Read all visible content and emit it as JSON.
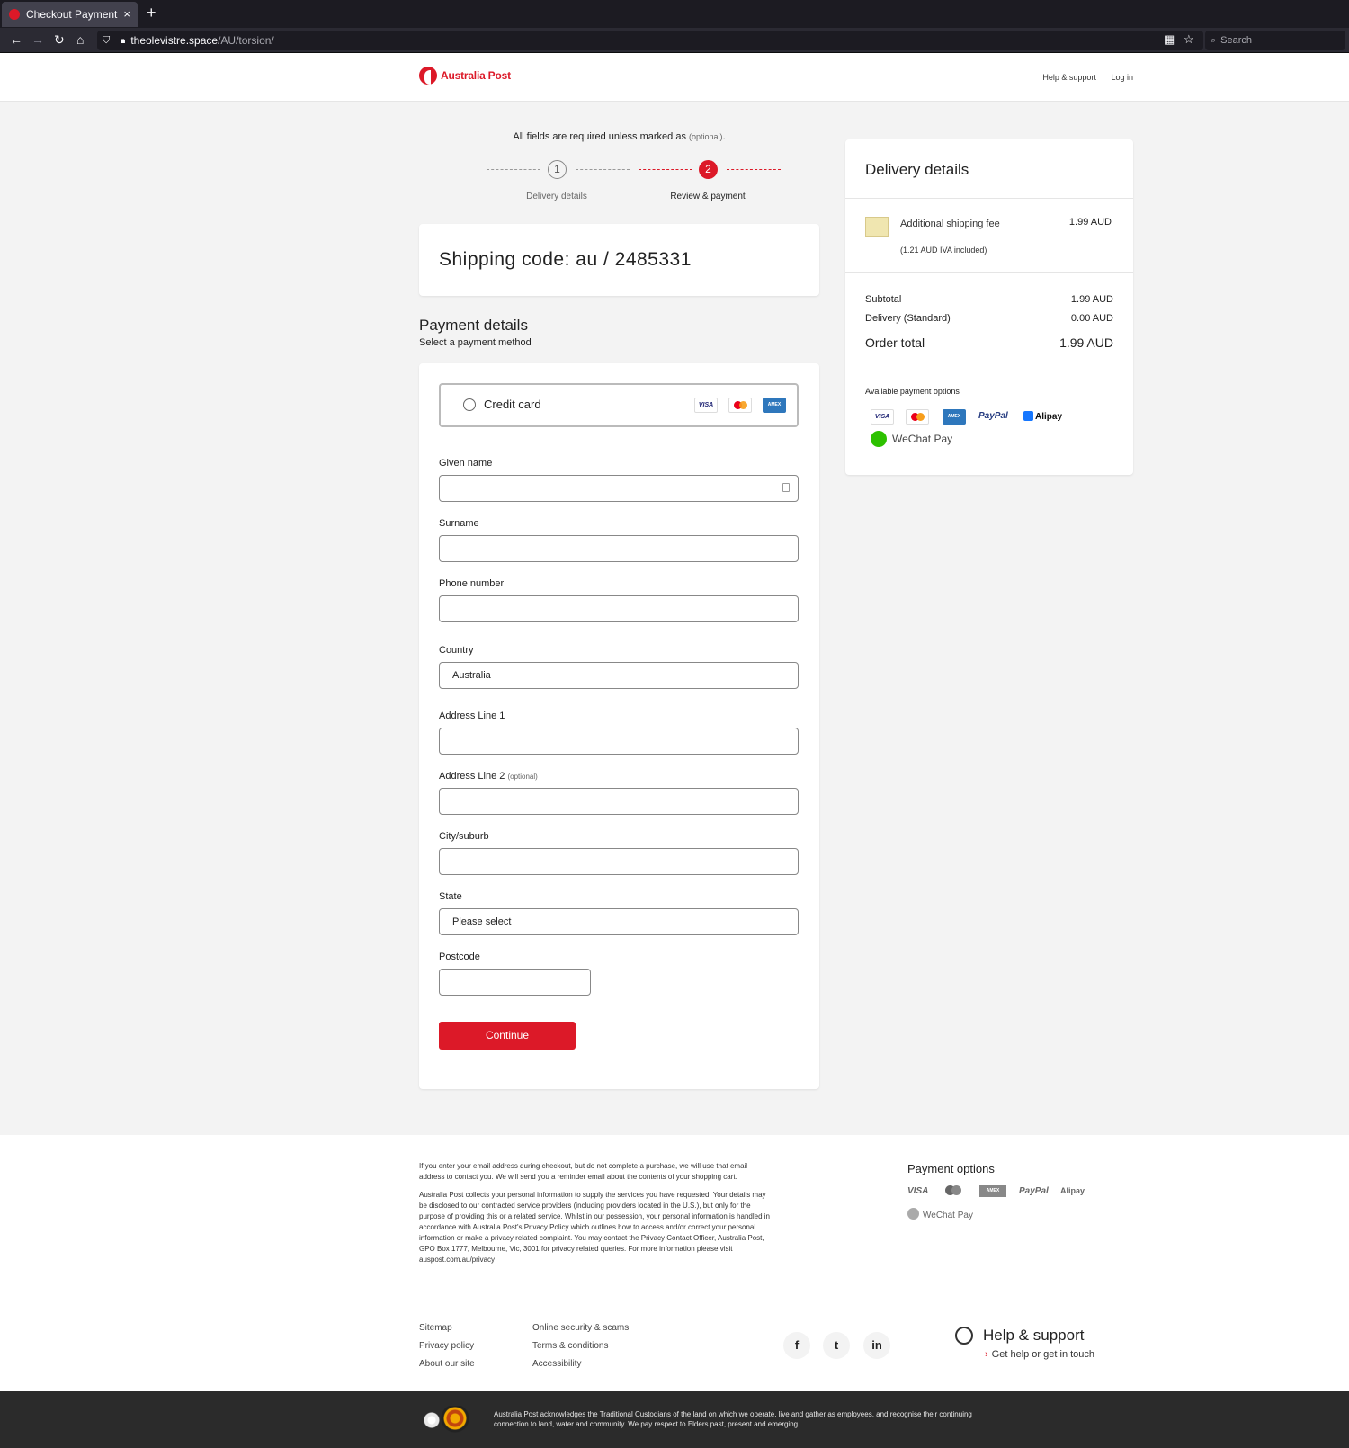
{
  "browser": {
    "tab_title": "Checkout Payment",
    "tab_close": "×",
    "new_tab": "+",
    "url_domain": "theolevistre.space",
    "url_path": "/AU/torsion/",
    "search_placeholder": "Search"
  },
  "header": {
    "brand": "Australia Post",
    "links": [
      "Help & support",
      "Log in"
    ]
  },
  "progress": {
    "required_note": "All fields are required unless marked as",
    "optional_word": "(optional)",
    "steps": [
      {
        "number": "1",
        "label": "Delivery details"
      },
      {
        "number": "2",
        "label": "Review & payment"
      }
    ]
  },
  "shipping": {
    "code": "Shipping code: au / 2485331"
  },
  "payment": {
    "title": "Payment details",
    "subtitle": "Select a payment method",
    "credit_card_label": "Credit card",
    "card_logos": [
      "VISA",
      "mastercard",
      "AMEX"
    ],
    "fields": {
      "given_name": {
        "label": "Given name",
        "value": ""
      },
      "surname": {
        "label": "Surname",
        "value": ""
      },
      "phone": {
        "label": "Phone number",
        "value": ""
      },
      "country": {
        "label": "Country",
        "value": "Australia"
      },
      "address1": {
        "label": "Address Line 1",
        "value": ""
      },
      "address2": {
        "label": "Address Line 2",
        "optional": "(optional)",
        "value": ""
      },
      "city": {
        "label": "City/suburb",
        "value": ""
      },
      "state": {
        "label": "State",
        "value": "Please select"
      },
      "postcode": {
        "label": "Postcode",
        "value": ""
      }
    },
    "continue_label": "Continue"
  },
  "summary": {
    "title": "Delivery details",
    "item": {
      "name": "Additional shipping fee",
      "tax_note": "(1.21 AUD IVA included)",
      "price": "1.99 AUD"
    },
    "subtotal_label": "Subtotal",
    "subtotal_value": "1.99 AUD",
    "delivery_label": "Delivery (Standard)",
    "delivery_value": "0.00 AUD",
    "total_label": "Order total",
    "total_value": "1.99 AUD",
    "available_label": "Available payment options",
    "payment_logos": [
      "VISA",
      "mastercard",
      "AMEX",
      "PayPal",
      "Alipay",
      "WeChat Pay"
    ]
  },
  "footer": {
    "email_notice": "If you enter your email address during checkout, but do not complete a purchase, we will use that email address to contact you. We will send you a reminder email about the contents of your shopping cart.",
    "privacy_notice": "Australia Post collects your personal information to supply the services you have requested. Your details may be disclosed to our contracted service providers (including providers located in the U.S.), but only for the purpose of providing this or a related service. Whilst in our possession, your personal information is handled in accordance with Australia Post's Privacy Policy which outlines how to access and/or correct your personal information or make a privacy related complaint. You may contact the Privacy Contact Officer, Australia Post, GPO Box 1777, Melbourne, Vic, 3001 for privacy related queries. For more information please visit auspost.com.au/privacy",
    "payment_options_title": "Payment options",
    "payment_logos": [
      "VISA",
      "mastercard",
      "AMEX",
      "PayPal",
      "Alipay",
      "WeChat Pay"
    ],
    "links_col1": [
      "Sitemap",
      "Privacy policy",
      "About our site"
    ],
    "links_col2": [
      "Online security & scams",
      "Terms & conditions",
      "Accessibility"
    ],
    "social": [
      "f",
      "t",
      "in"
    ],
    "help_title": "Help & support",
    "help_link": "Get help or get in touch",
    "acknowledgement": "Australia Post acknowledges the Traditional Custodians of the land on which we operate, live and gather as employees, and recognise their continuing connection to land, water and community. We pay respect to Elders past, present and emerging."
  },
  "colors": {
    "brand_red": "#dc1928",
    "page_bg": "#f3f3f3",
    "chrome_dark": "#1c1b22"
  }
}
